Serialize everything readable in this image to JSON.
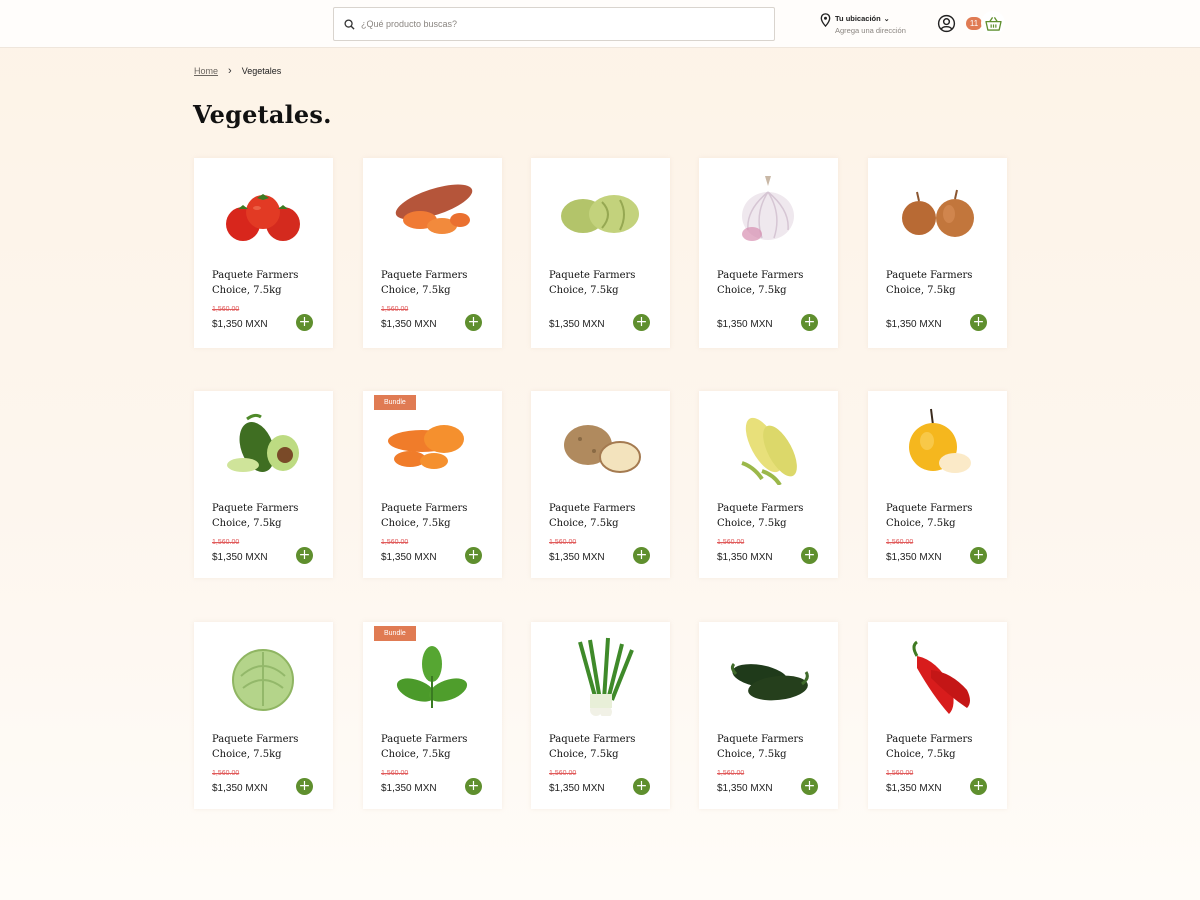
{
  "header": {
    "search_placeholder": "¿Qué producto buscas?",
    "location_title": "Tu ubicación",
    "location_chevron": "⌄",
    "location_subtitle": "Agrega una dirección",
    "cart_count": "11"
  },
  "breadcrumb": {
    "home": "Home",
    "separator": "›",
    "current": "Vegetales"
  },
  "page": {
    "title": "Vegetales."
  },
  "colors": {
    "accent": "#e07b53",
    "add_button": "#5f8f2e",
    "old_price": "#e05a5a"
  },
  "products": [
    {
      "icon": "tomato-icon",
      "badge": "",
      "name": "Paquete Farmers Choice, 7.5kg",
      "old_price": "1,560.00",
      "price": "$1,350 MXN"
    },
    {
      "icon": "sweet-potato-icon",
      "badge": "",
      "name": "Paquete Farmers Choice, 7.5kg",
      "old_price": "1,560.00",
      "price": "$1,350 MXN"
    },
    {
      "icon": "chayote-icon",
      "badge": "",
      "name": "Paquete Farmers Choice, 7.5kg",
      "old_price": "",
      "price": "$1,350 MXN"
    },
    {
      "icon": "garlic-icon",
      "badge": "",
      "name": "Paquete Farmers Choice, 7.5kg",
      "old_price": "",
      "price": "$1,350 MXN"
    },
    {
      "icon": "onion-icon",
      "badge": "",
      "name": "Paquete Farmers Choice, 7.5kg",
      "old_price": "",
      "price": "$1,350 MXN"
    },
    {
      "icon": "avocado-icon",
      "badge": "",
      "name": "Paquete Farmers Choice, 7.5kg",
      "old_price": "1,560.00",
      "price": "$1,350 MXN"
    },
    {
      "icon": "carrot-icon",
      "badge": "Bundle",
      "name": "Paquete Farmers Choice, 7.5kg",
      "old_price": "1,560.00",
      "price": "$1,350 MXN"
    },
    {
      "icon": "potato-icon",
      "badge": "",
      "name": "Paquete Farmers Choice, 7.5kg",
      "old_price": "1,560.00",
      "price": "$1,350 MXN"
    },
    {
      "icon": "corn-icon",
      "badge": "",
      "name": "Paquete Farmers Choice, 7.5kg",
      "old_price": "1,560.00",
      "price": "$1,350 MXN"
    },
    {
      "icon": "pear-icon",
      "badge": "",
      "name": "Paquete Farmers Choice, 7.5kg",
      "old_price": "1,560.00",
      "price": "$1,350 MXN"
    },
    {
      "icon": "lettuce-icon",
      "badge": "",
      "name": "Paquete Farmers Choice, 7.5kg",
      "old_price": "1,560.00",
      "price": "$1,350 MXN"
    },
    {
      "icon": "basil-icon",
      "badge": "Bundle",
      "name": "Paquete Farmers Choice, 7.5kg",
      "old_price": "1,560.00",
      "price": "$1,350 MXN"
    },
    {
      "icon": "green-onion-icon",
      "badge": "",
      "name": "Paquete Farmers Choice, 7.5kg",
      "old_price": "1,560.00",
      "price": "$1,350 MXN"
    },
    {
      "icon": "poblano-pepper-icon",
      "badge": "",
      "name": "Paquete Farmers Choice, 7.5kg",
      "old_price": "1,560.00",
      "price": "$1,350 MXN"
    },
    {
      "icon": "red-pepper-icon",
      "badge": "",
      "name": "Paquete Farmers Choice, 7.5kg",
      "old_price": "1,560.00",
      "price": "$1,350 MXN"
    }
  ]
}
